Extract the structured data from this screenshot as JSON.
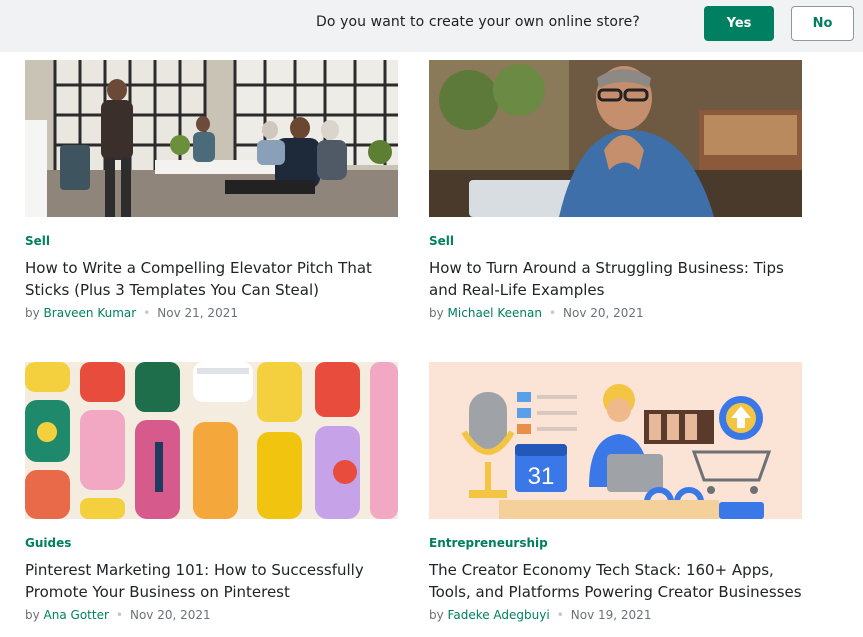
{
  "banner": {
    "question": "Do you want to create your own online store?",
    "yes_label": "Yes",
    "no_label": "No"
  },
  "articles": [
    {
      "category": "Sell",
      "title": "How to Write a Compelling Elevator Pitch That Sticks (Plus 3 Templates You Can Steal)",
      "by": "by",
      "author": "Braveen Kumar",
      "date": "Nov 21, 2021",
      "image": "office-meeting-photo"
    },
    {
      "category": "Sell",
      "title": "How to Turn Around a Struggling Business: Tips and Real-Life Examples",
      "by": "by",
      "author": "Michael Keenan",
      "date": "Nov 20, 2021",
      "image": "stressed-man-photo"
    },
    {
      "category": "Guides",
      "title": "Pinterest Marketing 101: How to Successfully Promote Your Business on Pinterest",
      "by": "by",
      "author": "Ana Gotter",
      "date": "Nov 20, 2021",
      "image": "pinterest-illustration"
    },
    {
      "category": "Entrepreneurship",
      "title": "The Creator Economy Tech Stack: 160+ Apps, Tools, and Platforms Powering Creator Businesses",
      "by": "by",
      "author": "Fadeke Adegbuyi",
      "date": "Nov 19, 2021",
      "image": "creator-economy-illustration",
      "calendar_day": "31"
    }
  ],
  "colors": {
    "accent": "#008060",
    "banner_bg": "#f1f2f3",
    "meta_text": "#6d7175"
  }
}
